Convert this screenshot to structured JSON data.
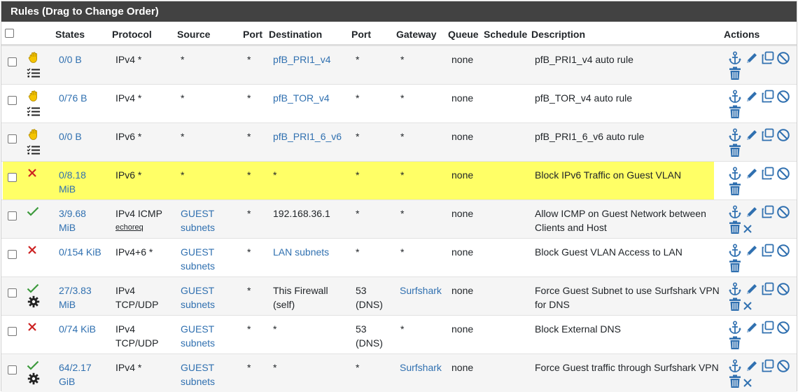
{
  "panel": {
    "title": "Rules (Drag to Change Order)"
  },
  "columns": {
    "states": "States",
    "protocol": "Protocol",
    "source": "Source",
    "port": "Port",
    "destination": "Destination",
    "port2": "Port",
    "gateway": "Gateway",
    "queue": "Queue",
    "schedule": "Schedule",
    "description": "Description",
    "actions": "Actions"
  },
  "colors": {
    "header_bg": "#424242",
    "link": "#3070b0",
    "highlight": "#ffff66",
    "pass": "#3c9a3c",
    "block": "#cc2222",
    "alt_row": "#f5f5f5"
  },
  "rules": [
    {
      "status_icon": "hand-icon",
      "extra_icon": "list-check-icon",
      "states": [
        "0/0 B"
      ],
      "protocol": [
        "IPv4 *"
      ],
      "protocol_sub": "",
      "source": [
        "*"
      ],
      "port": "*",
      "destination": [
        "pfB_PRI1_v4"
      ],
      "dest_link": true,
      "dport": [
        "*"
      ],
      "gateway": "*",
      "gateway_link": false,
      "queue": "none",
      "schedule": "",
      "description": [
        "pfB_PRI1_v4 auto rule"
      ],
      "extra_action": ""
    },
    {
      "status_icon": "hand-icon",
      "extra_icon": "list-check-icon",
      "states": [
        "0/76 B"
      ],
      "protocol": [
        "IPv4 *"
      ],
      "protocol_sub": "",
      "source": [
        "*"
      ],
      "port": "*",
      "destination": [
        "pfB_TOR_v4"
      ],
      "dest_link": true,
      "dport": [
        "*"
      ],
      "gateway": "*",
      "gateway_link": false,
      "queue": "none",
      "schedule": "",
      "description": [
        "pfB_TOR_v4 auto rule"
      ],
      "extra_action": ""
    },
    {
      "status_icon": "hand-icon",
      "extra_icon": "list-check-icon",
      "states": [
        "0/0 B"
      ],
      "protocol": [
        "IPv6 *"
      ],
      "protocol_sub": "",
      "source": [
        "*"
      ],
      "port": "*",
      "destination": [
        "pfB_PRI1_6_v6"
      ],
      "dest_link": true,
      "dport": [
        "*"
      ],
      "gateway": "*",
      "gateway_link": false,
      "queue": "none",
      "schedule": "",
      "description": [
        "pfB_PRI1_6_v6 auto rule"
      ],
      "extra_action": ""
    },
    {
      "status_icon": "block-x-icon",
      "extra_icon": "",
      "highlight": true,
      "states": [
        "0/8.18",
        "MiB"
      ],
      "protocol": [
        "IPv6 *"
      ],
      "protocol_sub": "",
      "source": [
        "*"
      ],
      "port": "*",
      "destination": [
        "*"
      ],
      "dest_link": false,
      "dport": [
        "*"
      ],
      "gateway": "*",
      "gateway_link": false,
      "queue": "none",
      "schedule": "",
      "description": [
        "Block IPv6 Traffic on Guest VLAN"
      ],
      "extra_action": ""
    },
    {
      "status_icon": "pass-check-icon",
      "extra_icon": "",
      "states": [
        "3/9.68",
        "MiB"
      ],
      "protocol": [
        "IPv4 ICMP"
      ],
      "protocol_sub": "echoreq",
      "source": [
        "GUEST",
        "subnets"
      ],
      "source_link": true,
      "port": "*",
      "destination": [
        "192.168.36.1"
      ],
      "dest_link": false,
      "dport": [
        "*"
      ],
      "gateway": "*",
      "gateway_link": false,
      "queue": "none",
      "schedule": "",
      "description": [
        "Allow ICMP on Guest Network between",
        "Clients and Host"
      ],
      "extra_action": "x"
    },
    {
      "status_icon": "block-x-icon",
      "extra_icon": "",
      "states": [
        "0/154 KiB"
      ],
      "protocol": [
        "IPv4+6 *"
      ],
      "protocol_sub": "",
      "source": [
        "GUEST",
        "subnets"
      ],
      "source_link": true,
      "port": "*",
      "destination": [
        "LAN subnets"
      ],
      "dest_link": true,
      "dport": [
        "*"
      ],
      "gateway": "*",
      "gateway_link": false,
      "queue": "none",
      "schedule": "",
      "description": [
        "Block Guest VLAN Access to LAN"
      ],
      "extra_action": ""
    },
    {
      "status_icon": "pass-check-icon",
      "extra_icon": "gear-icon",
      "states": [
        "27/3.83",
        "MiB"
      ],
      "protocol": [
        "IPv4",
        "TCP/UDP"
      ],
      "protocol_sub": "",
      "source": [
        "GUEST",
        "subnets"
      ],
      "source_link": true,
      "port": "*",
      "destination": [
        "This Firewall",
        "(self)"
      ],
      "dest_link": false,
      "dport": [
        "53",
        "(DNS)"
      ],
      "gateway": "Surfshark",
      "gateway_link": true,
      "queue": "none",
      "schedule": "",
      "description": [
        "Force Guest Subnet to use Surfshark VPN",
        "for DNS"
      ],
      "extra_action": "x"
    },
    {
      "status_icon": "block-x-icon",
      "extra_icon": "",
      "states": [
        "0/74 KiB"
      ],
      "protocol": [
        "IPv4",
        "TCP/UDP"
      ],
      "protocol_sub": "",
      "source": [
        "GUEST",
        "subnets"
      ],
      "source_link": true,
      "port": "*",
      "destination": [
        "*"
      ],
      "dest_link": false,
      "dport": [
        "53",
        "(DNS)"
      ],
      "gateway": "*",
      "gateway_link": false,
      "queue": "none",
      "schedule": "",
      "description": [
        "Block External DNS"
      ],
      "extra_action": ""
    },
    {
      "status_icon": "pass-check-icon",
      "extra_icon": "gear-icon",
      "states": [
        "64/2.17",
        "GiB"
      ],
      "protocol": [
        "IPv4 *"
      ],
      "protocol_sub": "",
      "source": [
        "GUEST",
        "subnets"
      ],
      "source_link": true,
      "port": "*",
      "destination": [
        "*"
      ],
      "dest_link": false,
      "dport": [
        "*"
      ],
      "gateway": "Surfshark",
      "gateway_link": true,
      "queue": "none",
      "schedule": "",
      "description": [
        "Force Guest traffic through Surfshark VPN"
      ],
      "extra_action": "x"
    }
  ]
}
